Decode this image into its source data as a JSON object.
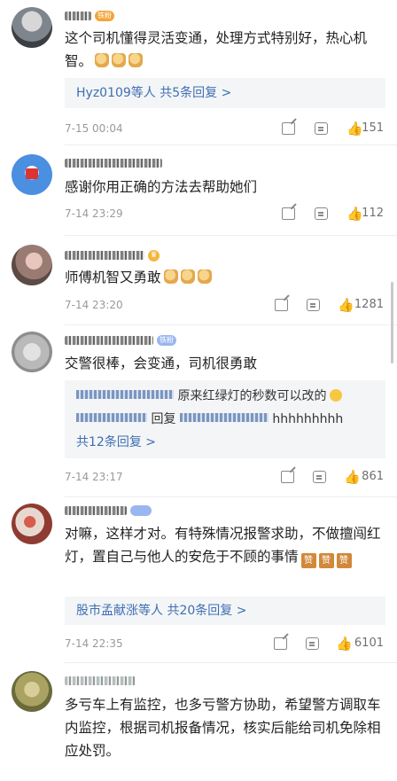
{
  "comments": [
    {
      "text": "这个司机懂得灵活变通，处理方式特别好，热心机智。",
      "badge": "铁粉",
      "reply_more": "Hyz0109等人 共5条回复 >",
      "time": "7-15 00:04",
      "likes": "151"
    },
    {
      "text": "感谢你用正确的方法去帮助她们",
      "time": "7-14 23:29",
      "likes": "112"
    },
    {
      "text": "师傅机智又勇敢",
      "time": "7-14 23:20",
      "likes": "1281"
    },
    {
      "text": "交警很棒，会变通，司机很勇敢",
      "badge": "铁粉",
      "reply_line1_text": "原来红绿灯的秒数可以改的",
      "reply_line2_label": "回复",
      "reply_line2_text": "hhhhhhhhh",
      "reply_more": "共12条回复 >",
      "time": "7-14 23:17",
      "likes": "861"
    },
    {
      "text": "对嘛，这样才对。有特殊情况报警求助，不做擅闯红灯，置自己与他人的安危于不顾的事情",
      "emoji_label": "赞",
      "reply_more": "股市孟献涨等人 共20条回复 >",
      "time": "7-14 22:35",
      "likes": "6101"
    },
    {
      "text": "多亏车上有监控，也多亏警方协助，希望警方调取车内监控，根据司机报备情况，核实后能给司机免除相应处罚。"
    }
  ],
  "colors": {
    "link": "#3d6fb3",
    "meta": "#9a9a9a",
    "badge_orange": "#f0a53a",
    "badge_blue": "#9ab6f0"
  },
  "icons": [
    "share-icon",
    "comment-icon",
    "thumbs-up-icon"
  ]
}
